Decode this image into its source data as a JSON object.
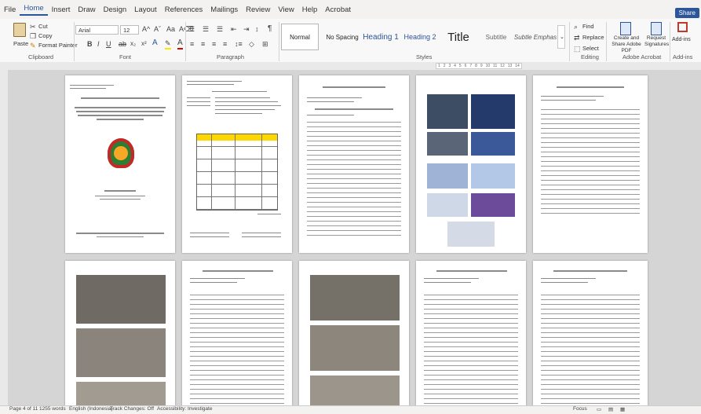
{
  "menu": {
    "tabs": [
      "File",
      "Home",
      "Insert",
      "Draw",
      "Design",
      "Layout",
      "References",
      "Mailings",
      "Review",
      "View",
      "Help",
      "Acrobat"
    ],
    "active": "Home",
    "share": "Share"
  },
  "clipboard": {
    "paste": "Paste",
    "cut": "Cut",
    "copy": "Copy",
    "format_painter": "Format Painter",
    "label": "Clipboard"
  },
  "font": {
    "name": "Arial",
    "size": "12",
    "label": "Font"
  },
  "paragraph": {
    "label": "Paragraph"
  },
  "styles": {
    "items": [
      "Normal",
      "No Spacing",
      "Heading 1",
      "Heading 2",
      "Title",
      "Subtitle",
      "Subtle Emphas"
    ],
    "label": "Styles"
  },
  "editing": {
    "find": "Find",
    "replace": "Replace",
    "select": "Select",
    "label": "Editing"
  },
  "acrobat": {
    "create": "Create and Share Adobe PDF",
    "request": "Request Signatures",
    "label": "Adobe Acrobat"
  },
  "addins": {
    "addin": "Add-ins",
    "label": "Add-ins"
  },
  "ruler_marks": [
    "1",
    "2",
    "3",
    "4",
    "5",
    "6",
    "7",
    "8",
    "9",
    "10",
    "11",
    "12",
    "13",
    "14"
  ],
  "status": {
    "page": "Page 4 of 11",
    "words": "1255 words",
    "language": "English (Indonesia)",
    "track": "Track Changes: Off",
    "accessibility": "Accessibility: Investigate",
    "focus": "Focus"
  }
}
